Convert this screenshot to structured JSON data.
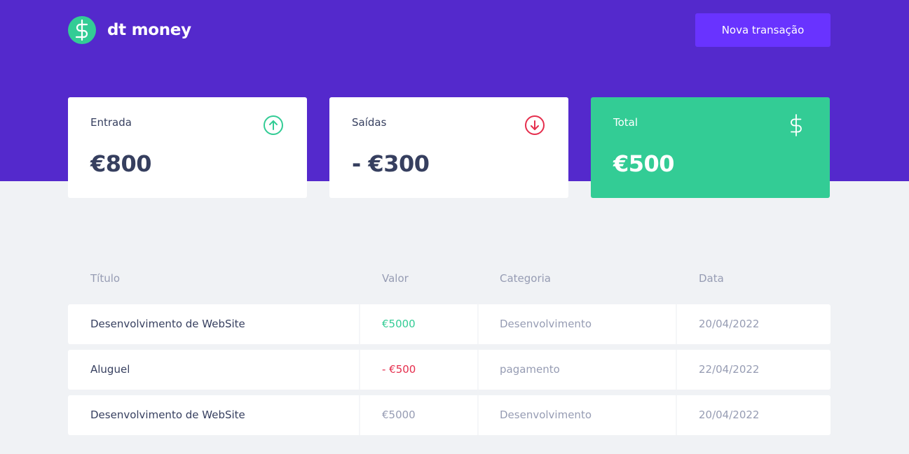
{
  "header": {
    "logo_text": "dt money",
    "new_button_label": "Nova transação"
  },
  "summary": {
    "income": {
      "label": "Entrada",
      "amount": "€800"
    },
    "outcome": {
      "label": "Saídas",
      "amount": "- €300"
    },
    "total": {
      "label": "Total",
      "amount": "€500"
    }
  },
  "table": {
    "columns": [
      "Título",
      "Valor",
      "Categoria",
      "Data"
    ],
    "rows": [
      {
        "title": "Desenvolvimento de WebSite",
        "value": "€5000",
        "category": "Desenvolvimento",
        "date": "20/04/2022",
        "type": "income"
      },
      {
        "title": "Aluguel",
        "value": "- €500",
        "category": "pagamento",
        "date": "22/04/2022",
        "type": "outcome"
      },
      {
        "title": "Desenvolvimento de WebSite",
        "value": "€5000",
        "category": "Desenvolvimento",
        "date": "20/04/2022",
        "type": "neutral"
      }
    ]
  },
  "colors": {
    "brand": "#5429cc",
    "button": "#6933ff",
    "income": "#33cc95",
    "outcome": "#e52e4d",
    "text": "#363f5f",
    "muted": "#969cb3"
  }
}
